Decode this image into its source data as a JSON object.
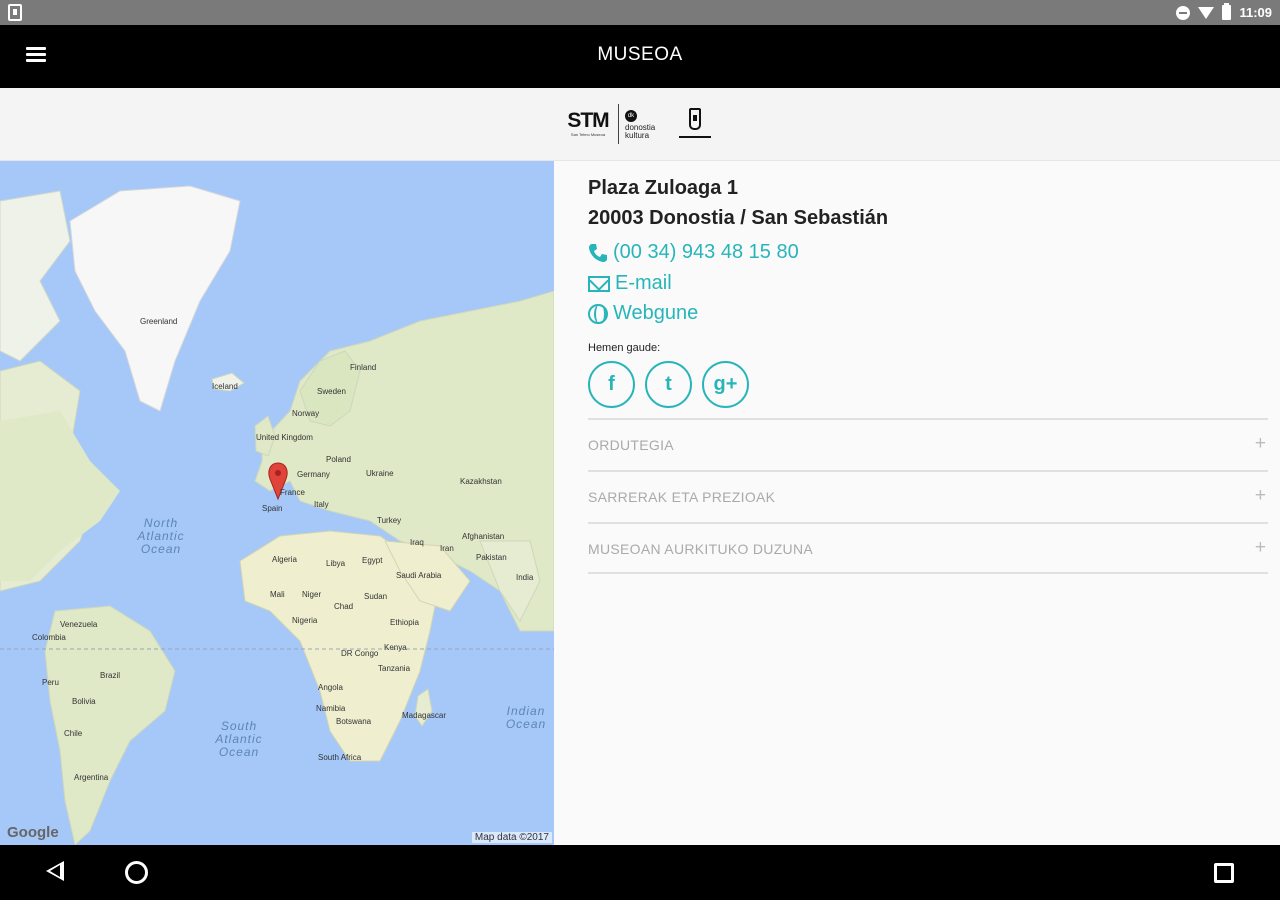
{
  "status_bar": {
    "time": "11:09"
  },
  "app_bar": {
    "title": "MUSEOA"
  },
  "logos": {
    "stm_big": "STM",
    "stm_small": "San Telmo Museoa",
    "dk_mark": "dk",
    "dk_text": "donostia kultura"
  },
  "map": {
    "labels": {
      "greenland": "Greenland",
      "iceland": "Iceland",
      "sweden": "Sweden",
      "finland": "Finland",
      "norway": "Norway",
      "united_kingdom": "United Kingdom",
      "germany": "Germany",
      "poland": "Poland",
      "ukraine": "Ukraine",
      "france": "France",
      "spain": "Spain",
      "italy": "Italy",
      "turkey": "Turkey",
      "kazakhstan": "Kazakhstan",
      "afghanistan": "Afghanistan",
      "iran": "Iran",
      "iraq": "Iraq",
      "pakistan": "Pakistan",
      "india": "India",
      "saudi_arabia": "Saudi Arabia",
      "egypt": "Egypt",
      "libya": "Libya",
      "algeria": "Algeria",
      "mali": "Mali",
      "niger": "Niger",
      "chad": "Chad",
      "sudan": "Sudan",
      "ethiopia": "Ethiopia",
      "nigeria": "Nigeria",
      "kenya": "Kenya",
      "drc": "DR Congo",
      "tanzania": "Tanzania",
      "angola": "Angola",
      "namibia": "Namibia",
      "botswana": "Botswana",
      "south_africa": "South Africa",
      "madagascar": "Madagascar",
      "venezuela": "Venezuela",
      "colombia": "Colombia",
      "peru": "Peru",
      "brazil": "Brazil",
      "bolivia": "Bolivia",
      "chile": "Chile",
      "argentina": "Argentina"
    },
    "oceans": {
      "north_atlantic": "North Atlantic Ocean",
      "south_atlantic": "South Atlantic Ocean",
      "indian": "Indian Ocean"
    },
    "google_logo": "Google",
    "credit": "Map data ©2017"
  },
  "info": {
    "address_line1": "Plaza Zuloaga 1",
    "address_line2": "20003 Donostia / San Sebastián",
    "phone": "(00 34) 943 48 15 80",
    "email_label": "E-mail",
    "web_label": "Webgune",
    "follow_label": "Hemen gaude:",
    "social": {
      "facebook": "f",
      "twitter": "t",
      "googleplus": "g+"
    },
    "accordion": [
      {
        "title": "ORDUTEGIA",
        "icon": "+"
      },
      {
        "title": "SARRERAK ETA PREZIOAK",
        "icon": "+"
      },
      {
        "title": "MUSEOAN AURKITUKO DUZUNA",
        "icon": "+"
      }
    ]
  },
  "colors": {
    "accent": "#28b5b9",
    "app_bar": "#000000",
    "map_water": "#a5c8f8",
    "map_land": "#e8eed3"
  }
}
